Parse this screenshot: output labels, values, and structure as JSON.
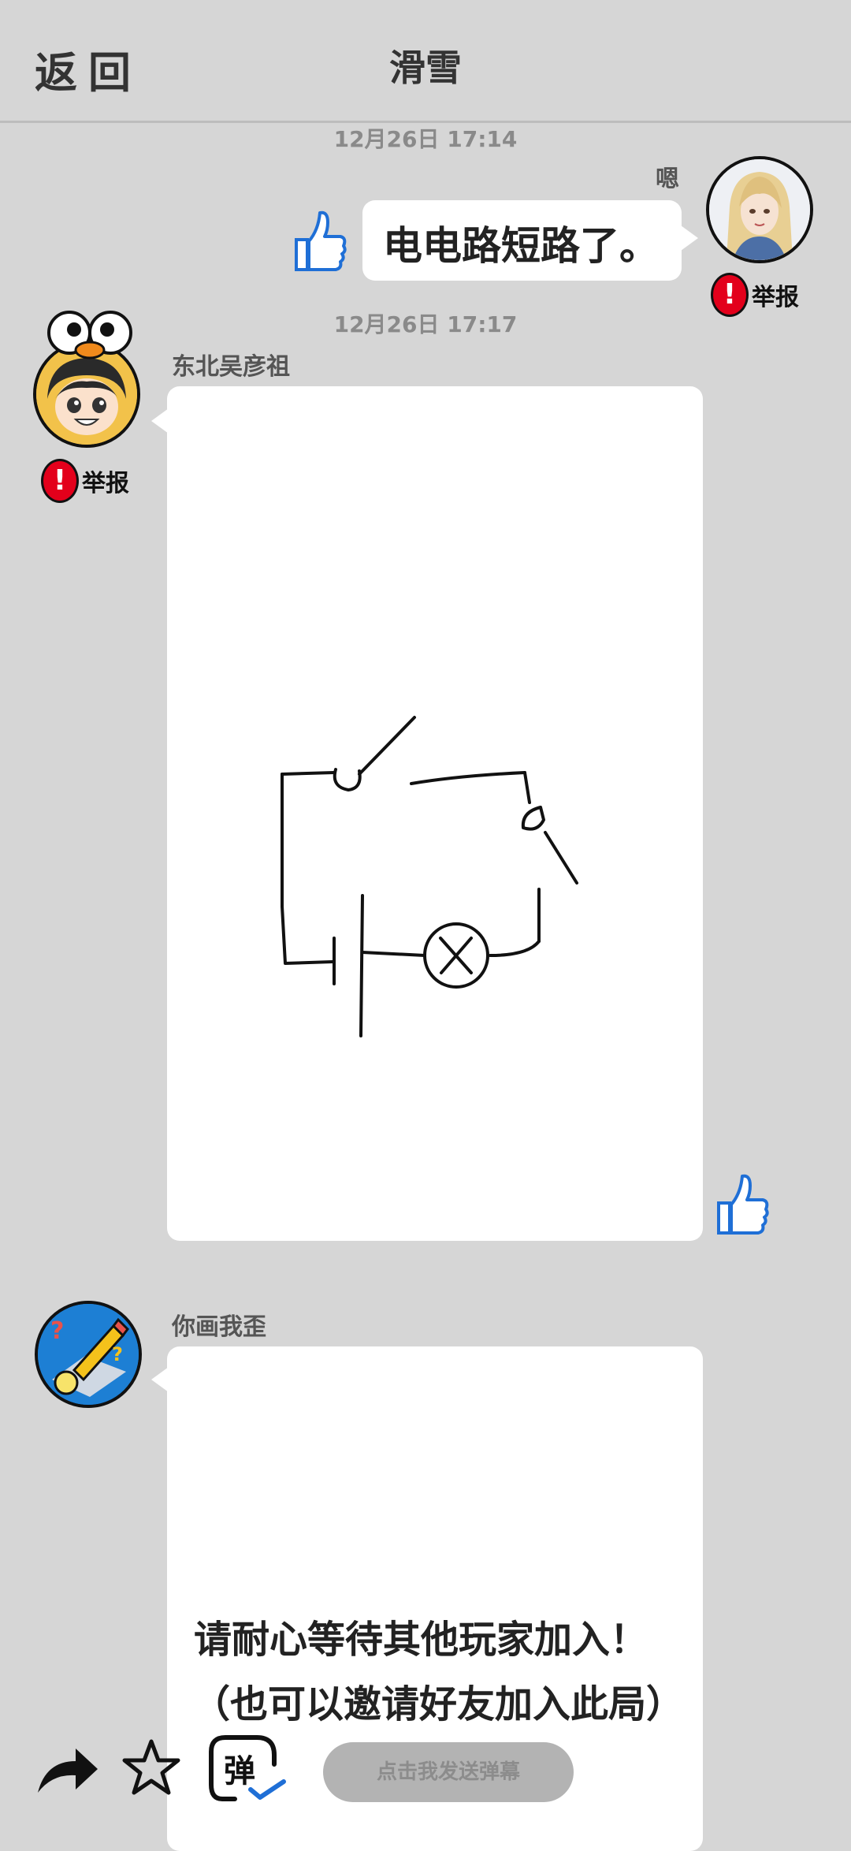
{
  "header": {
    "back_label": "返回",
    "title": "滑雪"
  },
  "messages": [
    {
      "time": "12月26日  17:14",
      "sender": "嗯",
      "text": "电电路短路了。",
      "report_label": "举报"
    },
    {
      "time": "12月26日  17:17",
      "sender": "东北吴彦祖",
      "report_label": "举报"
    },
    {
      "sender": "你画我歪"
    }
  ],
  "waiting": {
    "line1": "请耐心等待其他玩家加入！",
    "line2": "（也可以邀请好友加入此局）"
  },
  "bottom_bar": {
    "danmaku_icon_char": "弹",
    "danmaku_placeholder": "点击我发送弹幕"
  },
  "colors": {
    "background": "#d6d6d6",
    "report_red": "#e3001b",
    "thumb_blue": "#1f6fd6"
  }
}
